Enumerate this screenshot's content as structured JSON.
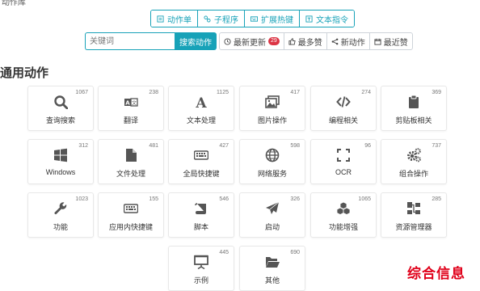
{
  "breadcrumb": "动作库",
  "tabs": [
    {
      "label": "动作单",
      "icon": "list-icon"
    },
    {
      "label": "子程序",
      "icon": "subroutine-icon"
    },
    {
      "label": "扩展热键",
      "icon": "keyboard-icon"
    },
    {
      "label": "文本指令",
      "icon": "text-command-icon"
    }
  ],
  "search": {
    "placeholder": "关键词",
    "button_label": "搜索动作"
  },
  "filters": [
    {
      "label": "最新更新",
      "badge": "29",
      "icon": "history-icon"
    },
    {
      "label": "最多赞",
      "icon": "thumbs-up-icon"
    },
    {
      "label": "新动作",
      "icon": "share-icon"
    },
    {
      "label": "最近赞",
      "icon": "calendar-icon"
    }
  ],
  "section_title": "通用动作",
  "cards": [
    {
      "label": "查询搜索",
      "count": "1067",
      "icon": "search-icon"
    },
    {
      "label": "翻译",
      "count": "238",
      "icon": "translate-icon"
    },
    {
      "label": "文本处理",
      "count": "1125",
      "icon": "font-icon"
    },
    {
      "label": "图片操作",
      "count": "417",
      "icon": "images-icon"
    },
    {
      "label": "编程相关",
      "count": "274",
      "icon": "code-icon"
    },
    {
      "label": "剪贴板相关",
      "count": "369",
      "icon": "clipboard-icon"
    },
    {
      "label": "Windows",
      "count": "312",
      "icon": "windows-icon"
    },
    {
      "label": "文件处理",
      "count": "481",
      "icon": "file-icon"
    },
    {
      "label": "全局快捷键",
      "count": "427",
      "icon": "keyboard-icon"
    },
    {
      "label": "网络服务",
      "count": "598",
      "icon": "globe-icon"
    },
    {
      "label": "OCR",
      "count": "96",
      "icon": "scan-icon"
    },
    {
      "label": "组合操作",
      "count": "737",
      "icon": "gears-icon"
    },
    {
      "label": "功能",
      "count": "1023",
      "icon": "wrench-icon"
    },
    {
      "label": "应用内快捷键",
      "count": "155",
      "icon": "keyboard-icon"
    },
    {
      "label": "脚本",
      "count": "546",
      "icon": "scroll-icon"
    },
    {
      "label": "启动",
      "count": "326",
      "icon": "paper-plane-icon"
    },
    {
      "label": "功能增强",
      "count": "1065",
      "icon": "cubes-icon"
    },
    {
      "label": "资源管理器",
      "count": "285",
      "icon": "sitemap-icon"
    },
    {
      "label": "示例",
      "count": "445",
      "icon": "presentation-icon"
    },
    {
      "label": "其他",
      "count": "690",
      "icon": "folder-open-icon"
    }
  ],
  "watermark": "综合信息",
  "colors": {
    "accent": "#17a2b8",
    "badge": "#dc3545",
    "icon": "#555555",
    "watermark": "#e0001a"
  }
}
